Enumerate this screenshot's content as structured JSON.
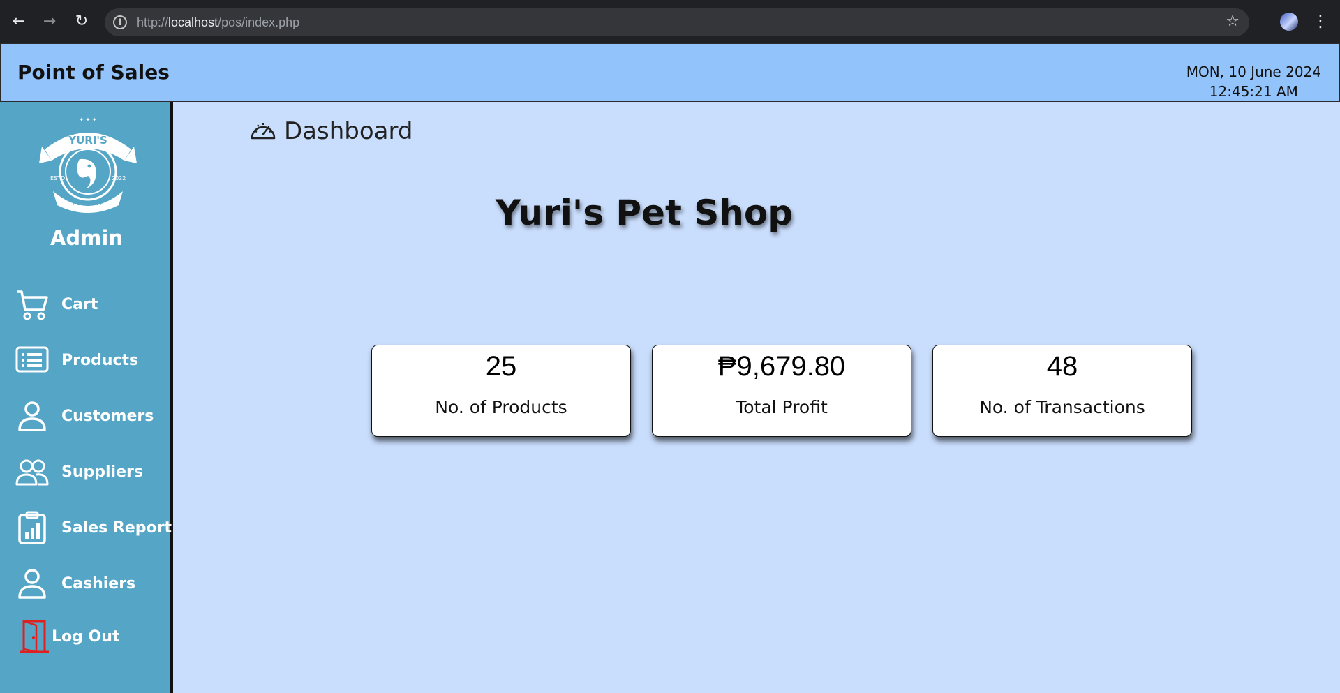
{
  "browser": {
    "url_prefix": "http://",
    "url_host": "localhost",
    "url_path": "/pos/index.php"
  },
  "header": {
    "title": "Point of Sales",
    "date": "MON, 10 June 2024",
    "time": "12:45:21 AM"
  },
  "sidebar": {
    "logo_text": {
      "top": "YURI'S",
      "left": "ESTD",
      "right": "2022",
      "bottom": "PET SHOP"
    },
    "role": "Admin",
    "items": [
      {
        "label": "Cart",
        "icon": "cart-icon"
      },
      {
        "label": "Products",
        "icon": "list-icon"
      },
      {
        "label": "Customers",
        "icon": "user-icon"
      },
      {
        "label": "Suppliers",
        "icon": "users-icon"
      },
      {
        "label": "Sales Report",
        "icon": "report-icon"
      },
      {
        "label": "Cashiers",
        "icon": "user-icon"
      },
      {
        "label": "Log Out",
        "icon": "door-icon"
      }
    ]
  },
  "main": {
    "section_title": "Dashboard",
    "shop_title": "Yuri's Pet Shop",
    "cards": [
      {
        "value": "25",
        "caption": "No. of Products"
      },
      {
        "value": "₱9,679.80",
        "caption": "Total Profit"
      },
      {
        "value": "48",
        "caption": "No. of Transactions"
      }
    ]
  },
  "colors": {
    "header_bg": "#93c3fb",
    "sidebar_bg": "#55a6c6",
    "main_bg": "#c9ddfc",
    "logout_icon": "#e0201e"
  }
}
